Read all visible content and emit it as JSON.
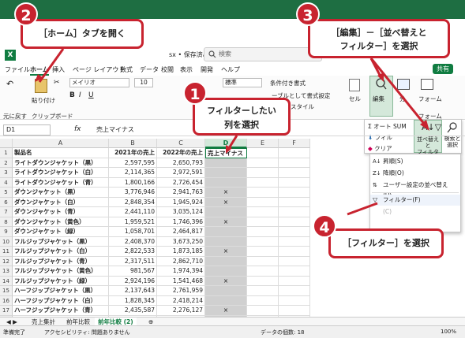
{
  "titlebar": {
    "filename_suffix": "sx • 保存済み",
    "search_placeholder": "検索"
  },
  "menu": {
    "items": [
      "ファイル",
      "ホーム",
      "挿入",
      "ページ レイアウト",
      "数式",
      "データ",
      "校閲",
      "表示",
      "開発",
      "ヘルプ"
    ],
    "share": "共有"
  },
  "ribbon": {
    "undo": "元に戻す",
    "paste": "貼り付け",
    "clipboard": "クリップボード",
    "font_name": "メイリオ",
    "font_size": "10",
    "number_format": "標準",
    "cond_format": "条件付き書式",
    "table_format": "ーブルとして書式設定",
    "style": "スタイル",
    "cells": "セル",
    "editing": "編集",
    "analysis": "分析",
    "form": "フォーム",
    "sub_group": "分"
  },
  "sort_menu": {
    "autosum": "オート SUM",
    "fill": "フィル",
    "clear": "クリア",
    "sort_filter": "並べ替えと\nフィルター",
    "find_select": "検索と\n選択"
  },
  "dropdown": {
    "asc": "昇順(S)",
    "desc": "降順(O)",
    "custom": "ユーザー設定の並べ替え(U)...",
    "filter": "フィルター(F)",
    "clear_e": "(C)"
  },
  "formula_bar": {
    "cell_ref": "D1",
    "fx": "fx",
    "content": "売上マイナス"
  },
  "columns": [
    "A",
    "B",
    "C",
    "D",
    "E",
    "F"
  ],
  "header_row": {
    "a": "製品名",
    "b": "2021年の売上",
    "c": "2022年の売上",
    "d": "売上マイナス"
  },
  "rows": [
    {
      "n": "2",
      "a": "ライトダウンジャケット（黒）",
      "b": "2,597,595",
      "c": "2,650,793",
      "d": ""
    },
    {
      "n": "3",
      "a": "ライトダウンジャケット（白）",
      "b": "2,114,365",
      "c": "2,972,591",
      "d": ""
    },
    {
      "n": "4",
      "a": "ライトダウンジャケット（青）",
      "b": "1,800,166",
      "c": "2,726,454",
      "d": ""
    },
    {
      "n": "5",
      "a": "ダウンジャケット（黒）",
      "b": "3,776,946",
      "c": "2,941,763",
      "d": "×"
    },
    {
      "n": "6",
      "a": "ダウンジャケット（白）",
      "b": "2,848,354",
      "c": "1,945,924",
      "d": "×"
    },
    {
      "n": "7",
      "a": "ダウンジャケット（青）",
      "b": "2,441,110",
      "c": "3,035,124",
      "d": ""
    },
    {
      "n": "8",
      "a": "ダウンジャケット（黄色）",
      "b": "1,959,521",
      "c": "1,746,396",
      "d": "×"
    },
    {
      "n": "9",
      "a": "ダウンジャケット（緑）",
      "b": "1,058,701",
      "c": "2,464,817",
      "d": ""
    },
    {
      "n": "10",
      "a": "フルジップジャケット（黒）",
      "b": "2,408,370",
      "c": "3,673,250",
      "d": ""
    },
    {
      "n": "11",
      "a": "フルジップジャケット（白）",
      "b": "2,822,533",
      "c": "1,873,185",
      "d": "×"
    },
    {
      "n": "12",
      "a": "フルジップジャケット（青）",
      "b": "2,317,511",
      "c": "2,862,710",
      "d": ""
    },
    {
      "n": "13",
      "a": "フルジップジャケット（黄色）",
      "b": "981,567",
      "c": "1,974,394",
      "d": ""
    },
    {
      "n": "14",
      "a": "フルジップジャケット（緑）",
      "b": "2,924,196",
      "c": "1,541,468",
      "d": "×"
    },
    {
      "n": "15",
      "a": "ハーフジップジャケット（黒）",
      "b": "2,137,643",
      "c": "2,761,959",
      "d": ""
    },
    {
      "n": "16",
      "a": "ハーフジップジャケット（白）",
      "b": "1,828,345",
      "c": "2,418,214",
      "d": ""
    },
    {
      "n": "17",
      "a": "ハーフジップジャケット（青）",
      "b": "2,435,587",
      "c": "2,276,127",
      "d": "×"
    },
    {
      "n": "18",
      "a": "ハーフジップジャケット（黄色）",
      "b": "2,938,254",
      "c": "1,731,426",
      "d": "×"
    }
  ],
  "sheet_tabs": [
    "売上集計",
    "前年比較",
    "前年比較 (2)"
  ],
  "status": {
    "ready": "準備完了",
    "accessibility": "アクセシビリティ: 問題ありません",
    "count": "データの個数: 18",
    "zoom": "100%"
  },
  "callouts": {
    "c1": {
      "num": "1",
      "text": "フィルターしたい\n列を選択"
    },
    "c2": {
      "num": "2",
      "text": "［ホーム］タブを開く"
    },
    "c3": {
      "num": "3",
      "text": "［編集］－［並べ替えと\nフィルター］を選択"
    },
    "c4": {
      "num": "4",
      "text": "［フィルター］を選択"
    }
  },
  "colors": {
    "accent": "#c8232f",
    "excel_green": "#107c41"
  }
}
